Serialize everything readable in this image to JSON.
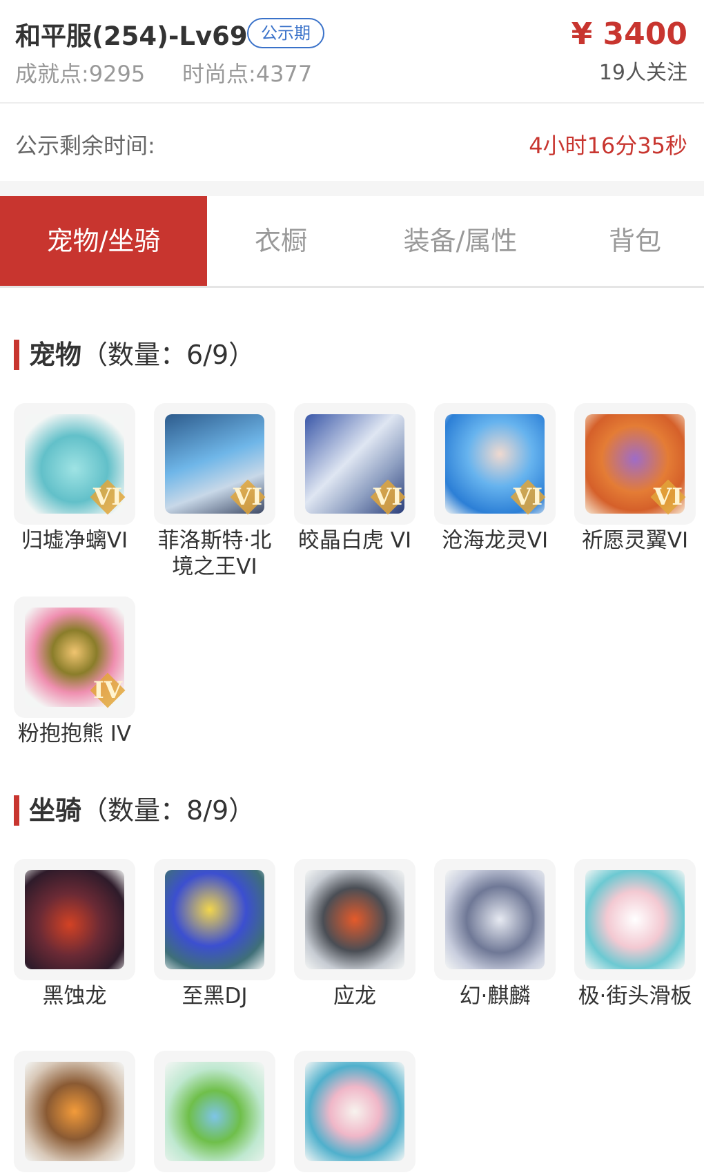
{
  "header": {
    "title": "和平服(254)-Lv69",
    "status_badge": "公示期",
    "price": "¥ 3400",
    "follows": "19人关注",
    "achievement": "成就点:9295",
    "fashion": "时尚点:4377"
  },
  "timer": {
    "label": "公示剩余时间:",
    "value": "4小时16分35秒"
  },
  "tabs": [
    {
      "label": "宠物/坐骑",
      "active": true
    },
    {
      "label": "衣橱",
      "active": false
    },
    {
      "label": "装备/属性",
      "active": false
    },
    {
      "label": "背包",
      "active": false
    }
  ],
  "pets": {
    "title": "宠物",
    "count": "（数量：6/9）",
    "items": [
      {
        "name": "归墟净螭VI",
        "tier": "VI"
      },
      {
        "name": "菲洛斯特·北境之王VI",
        "tier": "VI"
      },
      {
        "name": "皎晶白虎 VI",
        "tier": "VI"
      },
      {
        "name": "沧海龙灵VI",
        "tier": "VI"
      },
      {
        "name": "祈愿灵翼VI",
        "tier": "VI"
      },
      {
        "name": "粉抱抱熊 IV",
        "tier": "IV"
      }
    ]
  },
  "mounts": {
    "title": "坐骑",
    "count": "（数量：8/9）",
    "items": [
      {
        "name": "黑蚀龙"
      },
      {
        "name": "至黑DJ"
      },
      {
        "name": "应龙"
      },
      {
        "name": "幻·麒麟"
      },
      {
        "name": "极·街头滑板"
      },
      {
        "name": ""
      },
      {
        "name": ""
      },
      {
        "name": ""
      }
    ]
  },
  "colors": {
    "accent": "#c8352f",
    "badge_blue": "#3a72c9"
  }
}
